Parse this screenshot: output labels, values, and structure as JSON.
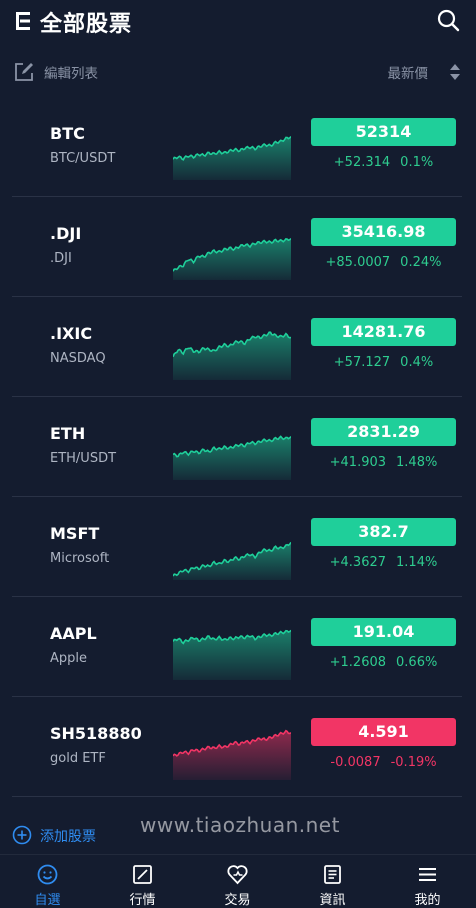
{
  "header": {
    "title": "全部股票"
  },
  "toolbar": {
    "edit_label": "編輯列表",
    "sort_label": "最新價"
  },
  "colors": {
    "up": "#1fcf9a",
    "down": "#f23565",
    "accent": "#2f8cf0"
  },
  "stocks": [
    {
      "symbol": "BTC",
      "name": "BTC/USDT",
      "price": "52314",
      "change": "+52.314",
      "pct": "0.1%",
      "direction": "up",
      "trend": [
        0.35,
        0.4,
        0.36,
        0.42,
        0.4,
        0.45,
        0.43,
        0.48,
        0.46,
        0.5,
        0.48,
        0.52,
        0.55,
        0.53,
        0.58,
        0.6,
        0.57,
        0.62,
        0.65,
        0.63,
        0.7,
        0.72,
        0.78,
        0.82
      ]
    },
    {
      "symbol": ".DJI",
      "name": ".DJI",
      "price": "35416.98",
      "change": "+85.0007",
      "pct": "0.24%",
      "direction": "up",
      "trend": [
        0.1,
        0.18,
        0.22,
        0.35,
        0.3,
        0.42,
        0.4,
        0.48,
        0.52,
        0.5,
        0.55,
        0.58,
        0.56,
        0.62,
        0.65,
        0.63,
        0.68,
        0.7,
        0.72,
        0.7,
        0.74,
        0.73,
        0.75,
        0.78
      ]
    },
    {
      "symbol": ".IXIC",
      "name": "NASDAQ",
      "price": "14281.76",
      "change": "+57.127",
      "pct": "0.4%",
      "direction": "up",
      "trend": [
        0.4,
        0.55,
        0.48,
        0.6,
        0.52,
        0.5,
        0.58,
        0.55,
        0.52,
        0.6,
        0.65,
        0.62,
        0.7,
        0.72,
        0.68,
        0.78,
        0.82,
        0.8,
        0.85,
        0.9,
        0.84,
        0.82,
        0.86,
        0.8
      ]
    },
    {
      "symbol": "ETH",
      "name": "ETH/USDT",
      "price": "2831.29",
      "change": "+41.903",
      "pct": "1.48%",
      "direction": "up",
      "trend": [
        0.45,
        0.42,
        0.5,
        0.46,
        0.52,
        0.48,
        0.55,
        0.5,
        0.58,
        0.56,
        0.6,
        0.58,
        0.62,
        0.65,
        0.63,
        0.7,
        0.68,
        0.72,
        0.75,
        0.73,
        0.78,
        0.8,
        0.78,
        0.82
      ]
    },
    {
      "symbol": "MSFT",
      "name": "Microsoft",
      "price": "382.7",
      "change": "+4.3627",
      "pct": "1.14%",
      "direction": "up",
      "trend": [
        0.0,
        0.05,
        0.12,
        0.1,
        0.18,
        0.15,
        0.22,
        0.2,
        0.28,
        0.25,
        0.32,
        0.3,
        0.38,
        0.35,
        0.42,
        0.45,
        0.4,
        0.5,
        0.55,
        0.52,
        0.6,
        0.58,
        0.62,
        0.7
      ]
    },
    {
      "symbol": "AAPL",
      "name": "Apple",
      "price": "191.04",
      "change": "+1.2608",
      "pct": "0.66%",
      "direction": "up",
      "trend": [
        0.72,
        0.78,
        0.7,
        0.75,
        0.8,
        0.74,
        0.77,
        0.82,
        0.76,
        0.8,
        0.75,
        0.79,
        0.78,
        0.82,
        0.8,
        0.84,
        0.78,
        0.82,
        0.86,
        0.84,
        0.88,
        0.9,
        0.92,
        0.95
      ]
    },
    {
      "symbol": "SH518880",
      "name": "gold ETF",
      "price": "4.591",
      "change": "-0.0087",
      "pct": "-0.19%",
      "direction": "down",
      "trend": [
        0.42,
        0.45,
        0.5,
        0.48,
        0.55,
        0.52,
        0.56,
        0.6,
        0.58,
        0.62,
        0.6,
        0.64,
        0.7,
        0.66,
        0.72,
        0.7,
        0.75,
        0.78,
        0.76,
        0.8,
        0.84,
        0.88,
        0.92,
        0.9
      ]
    }
  ],
  "add_label": "添加股票",
  "watermark": "www.tiaozhuan.net",
  "tabs": [
    {
      "label": "自選",
      "icon": "smiley-icon",
      "active": true
    },
    {
      "label": "行情",
      "icon": "chart-square-icon",
      "active": false
    },
    {
      "label": "交易",
      "icon": "trade-heart-icon",
      "active": false
    },
    {
      "label": "資訊",
      "icon": "news-icon",
      "active": false
    },
    {
      "label": "我的",
      "icon": "menu-lines-icon",
      "active": false
    }
  ]
}
